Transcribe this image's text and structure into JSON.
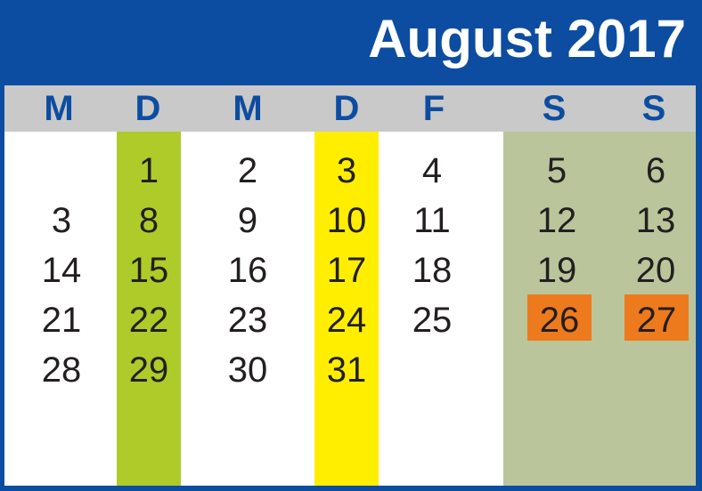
{
  "title": "August 2017",
  "weekdays": [
    "M",
    "D",
    "M",
    "D",
    "F",
    "S",
    "S"
  ],
  "weeks": [
    [
      "",
      "1",
      "2",
      "3",
      "4",
      "5",
      "6"
    ],
    [
      "3",
      "8",
      "9",
      "10",
      "11",
      "12",
      "13"
    ],
    [
      "14",
      "15",
      "16",
      "17",
      "18",
      "19",
      "20"
    ],
    [
      "21",
      "22",
      "23",
      "24",
      "25",
      "26",
      "27"
    ],
    [
      "28",
      "29",
      "30",
      "31",
      "",
      "",
      ""
    ]
  ],
  "highlighted_days": [
    "26",
    "27"
  ],
  "colors": {
    "frame": "#0d4da1",
    "header_band": "#c9c9c9",
    "column_2": "#aecb2a",
    "column_4": "#ffee00",
    "weekend": "#bac59c",
    "highlight": "#ee7a1e",
    "text": "#231f20"
  }
}
